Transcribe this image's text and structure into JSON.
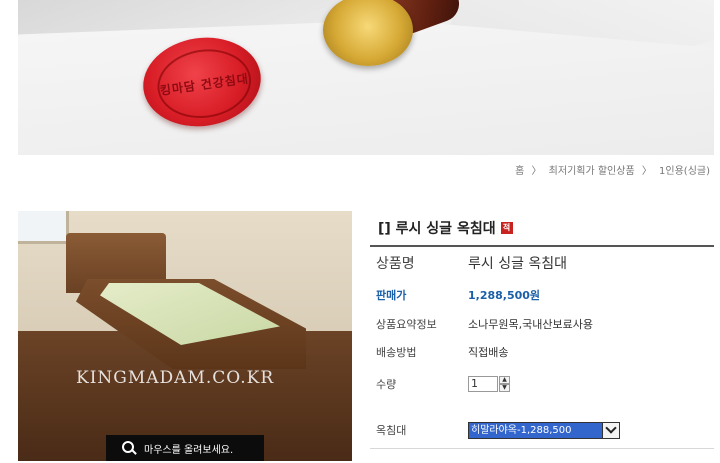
{
  "banner": {
    "seal_text": "킹마담 건강침대"
  },
  "breadcrumb": [
    "홈",
    "최저기획가 할인상품",
    "1인용(싱글)"
  ],
  "breadcrumb_sep": "〉",
  "photo": {
    "watermark": "KINGMADAM.CO.KR",
    "zoom_hint": "마우스를 올려보세요."
  },
  "product": {
    "title": "[] 루시 싱글 옥침대",
    "badge": "적",
    "rows": {
      "name": {
        "label": "상품명",
        "value": "루시 싱글 옥침대"
      },
      "price": {
        "label": "판매가",
        "value": "1,288,500원"
      },
      "summary": {
        "label": "상품요약정보",
        "value": "소나무원목,국내산보료사용"
      },
      "shipping": {
        "label": "배송방법",
        "value": "직접배송"
      },
      "quantity": {
        "label": "수량",
        "value": "1"
      },
      "option": {
        "label": "옥침대",
        "selected": "히말라야옥-1,288,500"
      }
    }
  },
  "colors": {
    "accent_blue": "#1a5fa8",
    "select_highlight": "#3366cc",
    "wax_red": "#d81d26"
  }
}
